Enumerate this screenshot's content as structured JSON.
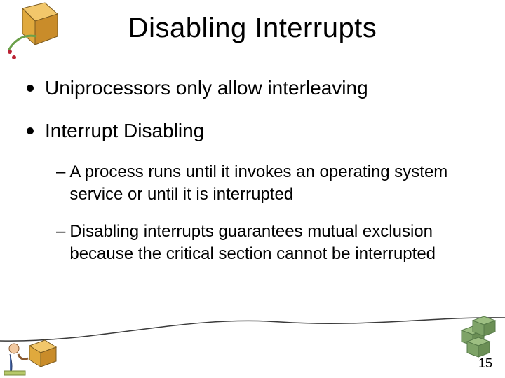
{
  "title": "Disabling Interrupts",
  "bullets": {
    "b1": "Uniprocessors only allow interleaving",
    "b2": "Interrupt Disabling",
    "b2_sub1": "A process runs until it invokes an operating system service or until it is interrupted",
    "b2_sub2": "Disabling interrupts guarantees mutual exclusion because the critical section cannot be interrupted"
  },
  "page_number": "15"
}
